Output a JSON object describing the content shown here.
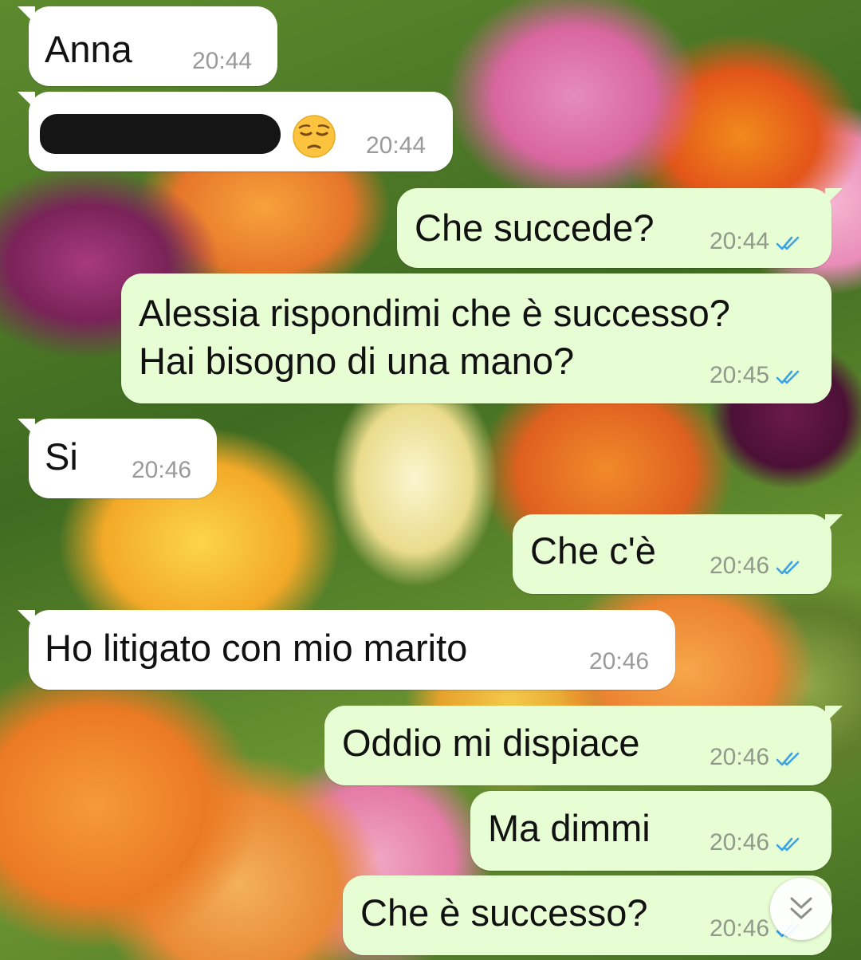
{
  "background": {
    "style": "tulip-field-wallpaper"
  },
  "colors": {
    "incoming_bubble": "#ffffff",
    "outgoing_bubble": "#e7fdd3",
    "read_ticks": "#3aa3e6",
    "timestamp": "#8f9a8a"
  },
  "messages": [
    {
      "direction": "incoming",
      "text": "Anna",
      "time": "20:44"
    },
    {
      "direction": "incoming",
      "text": "",
      "redacted": true,
      "emoji": "pensive-face",
      "time": "20:44"
    },
    {
      "direction": "outgoing",
      "text": "Che succede?",
      "time": "20:44",
      "status": "read"
    },
    {
      "direction": "outgoing",
      "text": "Alessia rispondimi che è successo?\nHai bisogno di una mano?",
      "time": "20:45",
      "status": "read"
    },
    {
      "direction": "incoming",
      "text": "Si",
      "time": "20:46"
    },
    {
      "direction": "outgoing",
      "text": "Che c'è",
      "time": "20:46",
      "status": "read"
    },
    {
      "direction": "incoming",
      "text": "Ho litigato con mio marito",
      "time": "20:46"
    },
    {
      "direction": "outgoing",
      "text": "Oddio mi dispiace",
      "time": "20:46",
      "status": "read"
    },
    {
      "direction": "outgoing",
      "text": "Ma dimmi",
      "time": "20:46",
      "status": "read"
    },
    {
      "direction": "outgoing",
      "text": "Che è successo?",
      "time": "20:46",
      "status": "read"
    }
  ],
  "scroll_button": {
    "icon": "double-chevron-down-icon"
  }
}
